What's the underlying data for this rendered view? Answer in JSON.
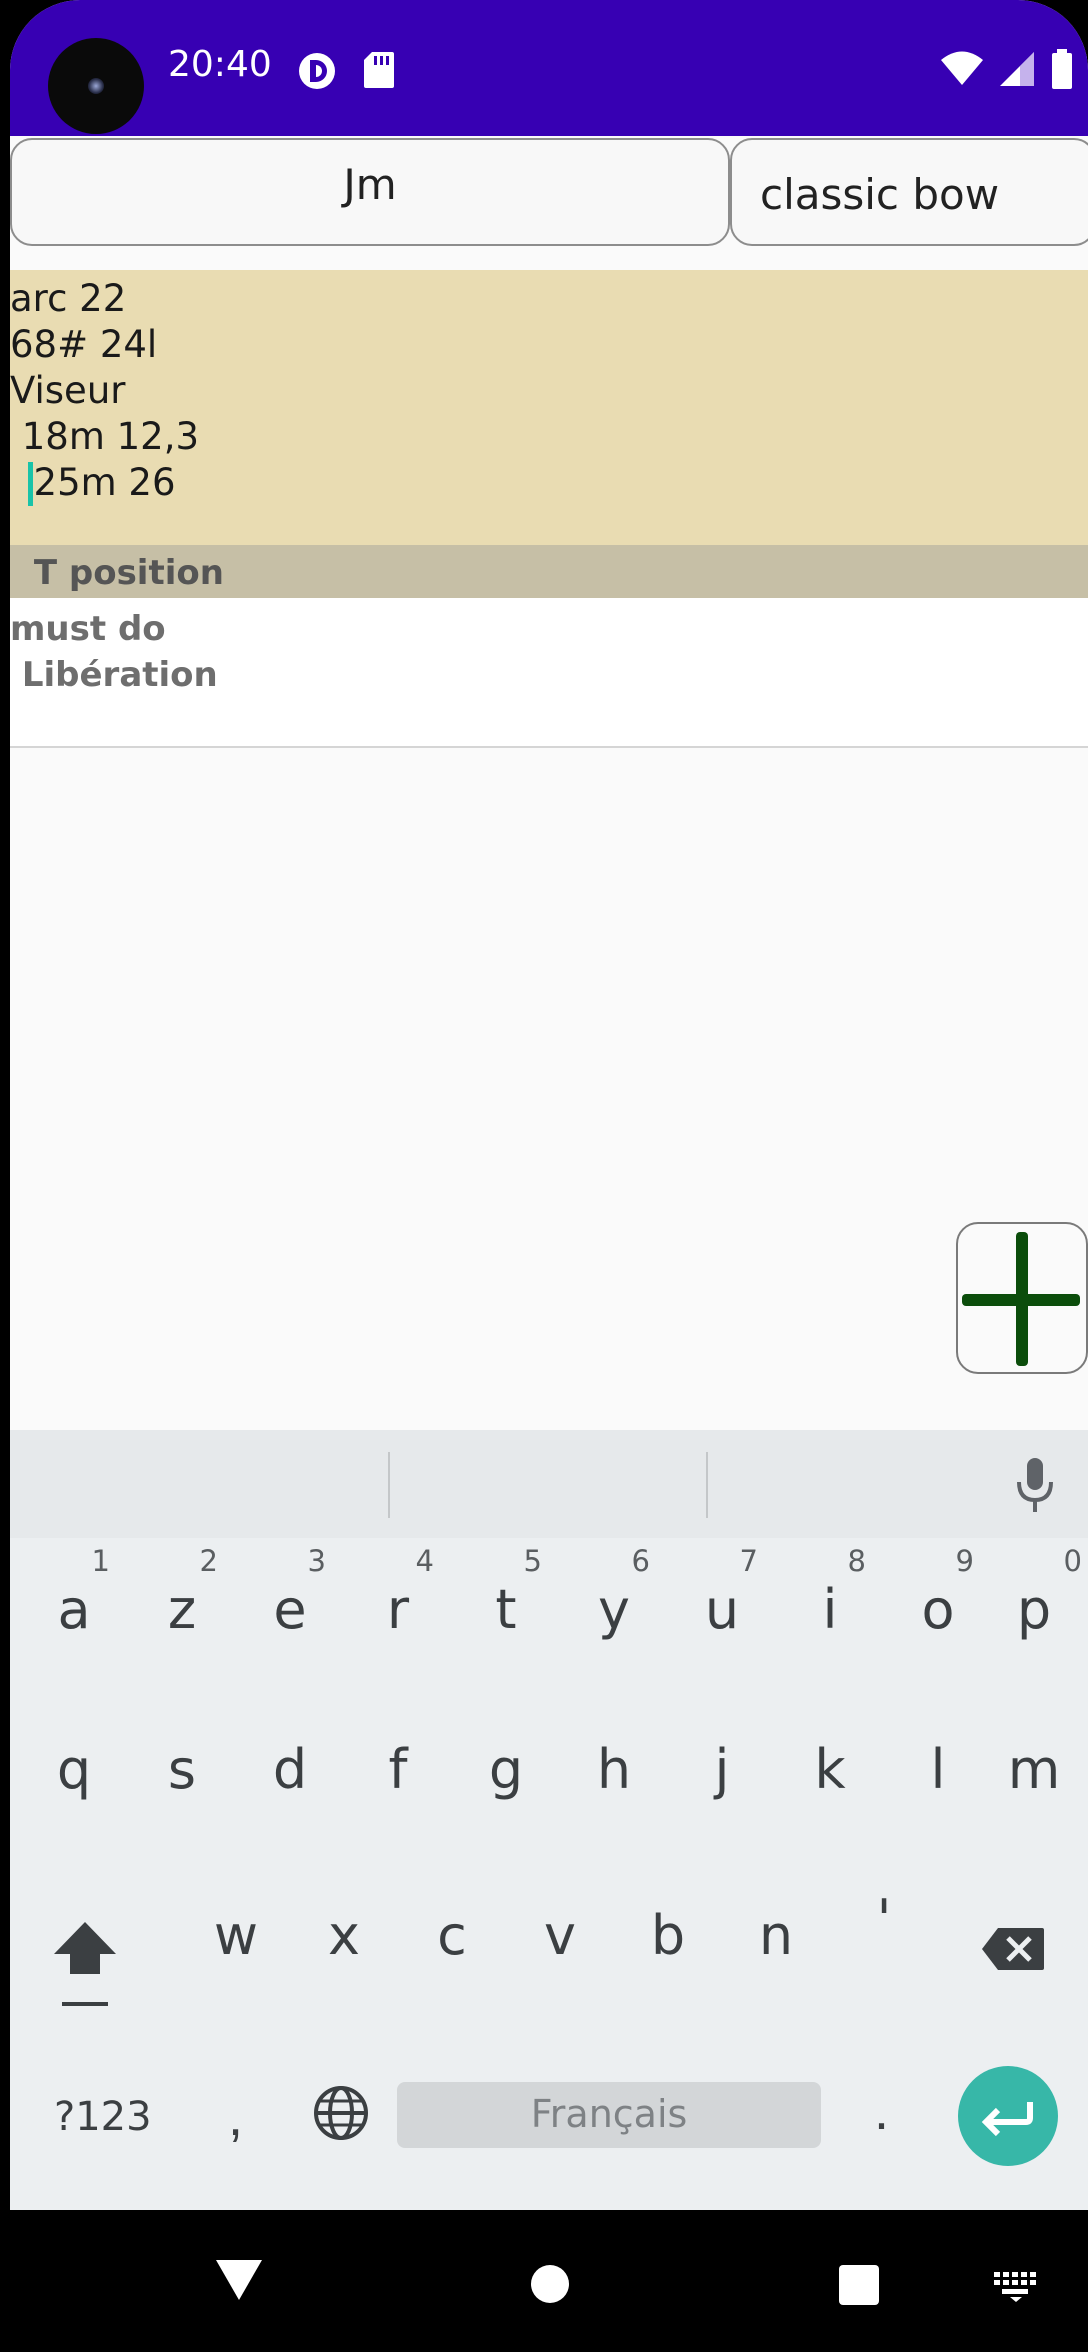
{
  "status_bar": {
    "time": "20:40",
    "left_icons": [
      "data-saver-icon",
      "sd-card-icon"
    ],
    "right_icons": [
      "wifi-icon",
      "signal-icon",
      "battery-icon"
    ],
    "background": "#3700b3"
  },
  "top_bar": {
    "user_label": "Jm",
    "bow_label": "classic bow"
  },
  "notes": {
    "lines": [
      "arc 22",
      "68# 24l",
      "Viseur",
      " 18m 12,3",
      "  25m 26"
    ],
    "background": "#e9dcb2",
    "cursor_color": "#19c3a8"
  },
  "section": {
    "header": " T position",
    "items": [
      "must do",
      " Libération"
    ]
  },
  "fab": {
    "icon": "plus-icon",
    "color": "#0b4d0b"
  },
  "keyboard": {
    "row1": [
      {
        "key": "a",
        "hint": "1"
      },
      {
        "key": "z",
        "hint": "2"
      },
      {
        "key": "e",
        "hint": "3"
      },
      {
        "key": "r",
        "hint": "4"
      },
      {
        "key": "t",
        "hint": "5"
      },
      {
        "key": "y",
        "hint": "6"
      },
      {
        "key": "u",
        "hint": "7"
      },
      {
        "key": "i",
        "hint": "8"
      },
      {
        "key": "o",
        "hint": "9"
      },
      {
        "key": "p",
        "hint": "0"
      }
    ],
    "row2": [
      "q",
      "s",
      "d",
      "f",
      "g",
      "h",
      "j",
      "k",
      "l",
      "m"
    ],
    "row3": [
      "w",
      "x",
      "c",
      "v",
      "b",
      "n",
      "'"
    ],
    "symbols_label": "?123",
    "comma_label": ",",
    "space_label": "Français",
    "period_label": ".",
    "enter_color": "#37b7a8"
  },
  "nav_bar": {
    "icons": [
      "back-icon",
      "home-icon",
      "recents-icon",
      "keyboard-switch-icon"
    ]
  }
}
